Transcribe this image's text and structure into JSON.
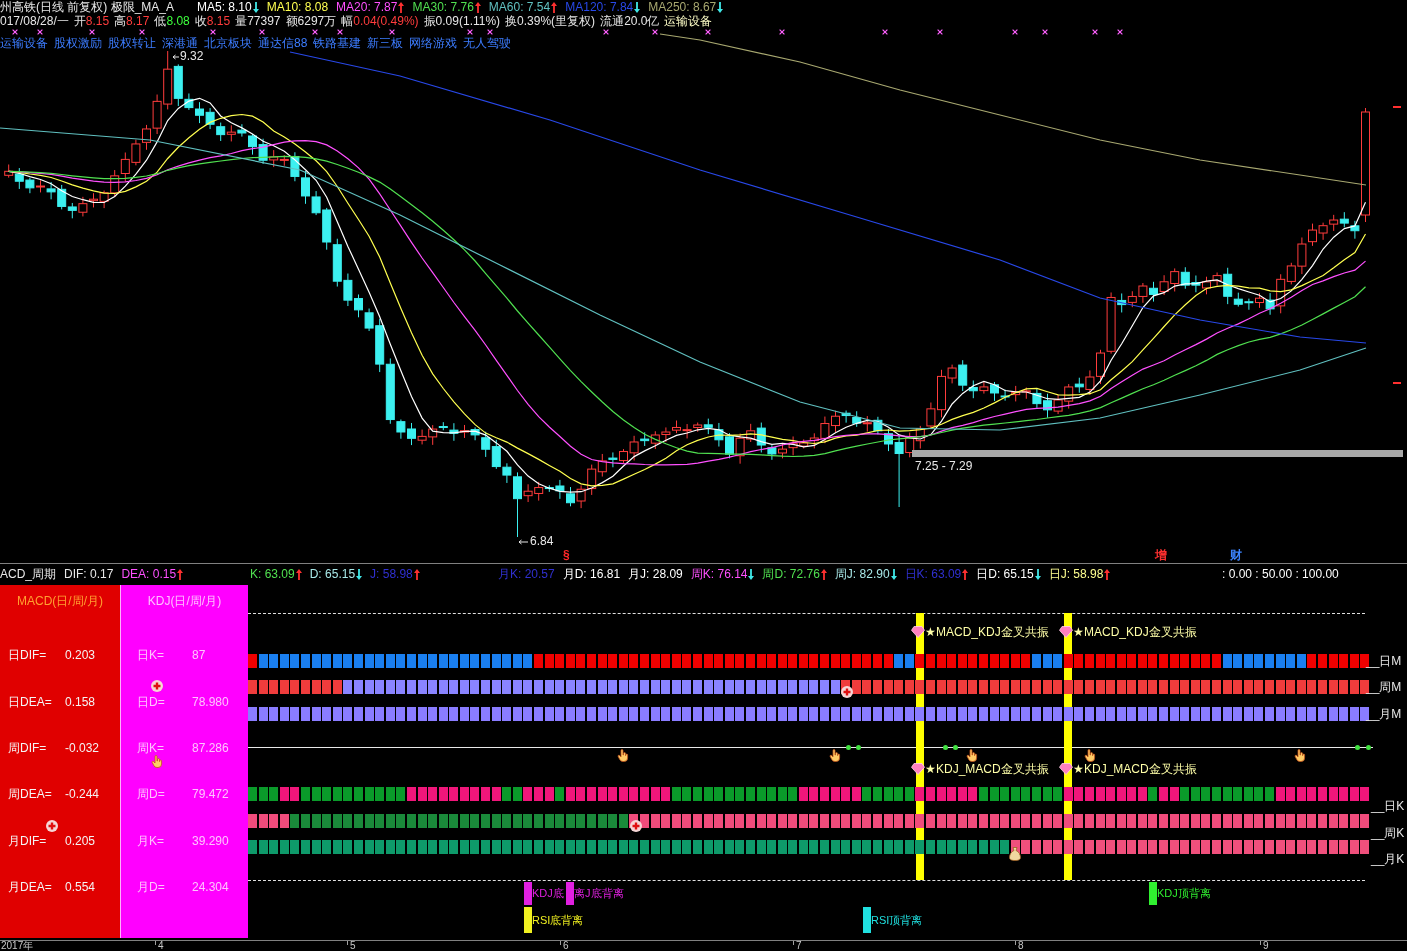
{
  "header": {
    "title": "州高铁(日线 前复权) 极限_MA_A",
    "ma_readings": [
      {
        "text": "MA5: 8.10",
        "color": "#ffffff",
        "rising": false
      },
      {
        "text": "MA10: 8.08",
        "color": "#ffff50"
      },
      {
        "text": "MA20: 7.87",
        "color": "#ff50ff",
        "rising": true
      },
      {
        "text": "MA30: 7.76",
        "color": "#50e050",
        "rising": true
      },
      {
        "text": "MA60: 7.54",
        "color": "#60c0c0",
        "rising": true
      },
      {
        "text": "MA120: 7.84",
        "color": "#2848e8",
        "rising": false
      },
      {
        "text": "MA250: 8.67",
        "color": "#a8a870",
        "rising": false
      }
    ]
  },
  "quote": {
    "date": "017/08/28/一",
    "fields": [
      {
        "label": "开",
        "value": "8.15",
        "color": "#ff3c3c"
      },
      {
        "label": "高",
        "value": "8.17",
        "color": "#ff3c3c"
      },
      {
        "label": "低",
        "value": "8.08",
        "color": "#3cff3c"
      },
      {
        "label": "收",
        "value": "8.15",
        "color": "#ff3c3c"
      },
      {
        "label": "量",
        "value": "77397",
        "color": "#e6e6e6"
      },
      {
        "label": "额",
        "value": "6297万",
        "color": "#e6e6e6"
      },
      {
        "label": "幅",
        "value": "0.04(0.49%)",
        "color": "#ff3c3c"
      },
      {
        "label": "振",
        "value": "0.09(1.11%)",
        "color": "#e6e6e6"
      },
      {
        "label": "换",
        "value": "0.39%(里复权)",
        "color": "#e6e6e6"
      },
      {
        "label": "流通",
        "value": "20.0亿",
        "color": "#e6e6e6"
      }
    ],
    "sector": "运输设备"
  },
  "concepts": [
    "运输设备",
    "股权激励",
    "股权转让",
    "深港通",
    "北京板块",
    "通达信88",
    "铁路基建",
    "新三板",
    "网络游戏",
    "无人驾驶"
  ],
  "chart": {
    "high_label": "9.32",
    "low_label": "6.84",
    "range_label": "7.25 - 7.29",
    "event_marks": [
      {
        "text": "§",
        "color": "#ff2828"
      },
      {
        "text": "增",
        "color": "#ff3030"
      },
      {
        "text": "财",
        "color": "#3c84ff"
      }
    ]
  },
  "indicator_bar": {
    "groups": [
      [
        {
          "text": "ACD_周期",
          "color": "#e8e8e8"
        },
        {
          "text": "DIF: 0.17",
          "color": "#e8e8e8"
        },
        {
          "text": "DEA: 0.15",
          "color": "#ff50ff",
          "rising": true
        }
      ],
      [
        {
          "text": "K: 63.09",
          "color": "#50e050",
          "rising": true
        },
        {
          "text": "D: 65.15",
          "color": "#a8e8e8",
          "rising": false
        },
        {
          "text": "J: 58.98",
          "color": "#3030d0",
          "rising": true
        }
      ],
      [
        {
          "text": "月K: 20.57",
          "color": "#3030d0"
        },
        {
          "text": "月D: 16.81",
          "color": "#ffffff"
        },
        {
          "text": "月J: 28.09",
          "color": "#ffffff"
        },
        {
          "text": "周K: 76.14",
          "color": "#ff50ff",
          "rising": false
        },
        {
          "text": "周D: 72.76",
          "color": "#50e050",
          "rising": true
        },
        {
          "text": "周J: 82.90",
          "color": "#a8e8e8",
          "rising": false
        },
        {
          "text": "日K: 63.09",
          "color": "#3030d0",
          "rising": true
        },
        {
          "text": "日D: 65.15",
          "color": "#ffffff",
          "rising": false
        },
        {
          "text": "日J: 58.98",
          "color": "#ffff90",
          "rising": true
        }
      ],
      [
        {
          "text": ": 0.00 : 50.00 : 100.00",
          "color": "#ffffff"
        }
      ]
    ]
  },
  "macd_panel": {
    "title": "MACD(日/周/月)",
    "rows": [
      {
        "label": "日DIF=",
        "value": "0.203"
      },
      {
        "label": "日DEA=",
        "value": "0.158"
      },
      {
        "label": "周DIF=",
        "value": "-0.032"
      },
      {
        "label": "周DEA=",
        "value": "-0.244"
      },
      {
        "label": "月DIF=",
        "value": "0.205"
      },
      {
        "label": "月DEA=",
        "value": "0.554"
      }
    ]
  },
  "kdj_panel": {
    "title": "KDJ(日/周/月)",
    "rows": [
      {
        "label": "日K=",
        "value": "87"
      },
      {
        "label": "日D=",
        "value": "78.980"
      },
      {
        "label": "周K=",
        "value": "87.286"
      },
      {
        "label": "周D=",
        "value": "79.472"
      },
      {
        "label": "月K=",
        "value": "39.290"
      },
      {
        "label": "月D=",
        "value": "24.304"
      }
    ]
  },
  "signals": {
    "macd_kdj_labels": [
      "★MACD_KDJ金叉共振",
      "★MACD_KDJ金叉共振"
    ],
    "kdj_macd_labels": [
      "★KDJ_MACD金叉共振",
      "★KDJ_MACD金叉共振"
    ],
    "ma_rows": [
      {
        "label": "__日M",
        "bullish": [
          true,
          false,
          false,
          false,
          false,
          false,
          false,
          false,
          false,
          false,
          false,
          false,
          false,
          false,
          false,
          false,
          false,
          false,
          false,
          false,
          false,
          false,
          false,
          false,
          false,
          false,
          false,
          true,
          true,
          true,
          true,
          true,
          true,
          true,
          true,
          true,
          true,
          true,
          true,
          true,
          true,
          true,
          true,
          true,
          true,
          true,
          true,
          true,
          true,
          true,
          true,
          true,
          true,
          true,
          true,
          true,
          true,
          true,
          true,
          true,
          true,
          false,
          false,
          true,
          true,
          true,
          true,
          true,
          true,
          true,
          true,
          true,
          true,
          true,
          false,
          false,
          false,
          true,
          true,
          true,
          true,
          true,
          true,
          true,
          true,
          true,
          true,
          true,
          true,
          true,
          true,
          true,
          false,
          false,
          false,
          false,
          false,
          false,
          false,
          false,
          true,
          true,
          true,
          true,
          true,
          true
        ]
      },
      {
        "label": "__周M",
        "bullish": [
          true,
          true,
          true,
          true,
          true,
          true,
          true,
          true,
          true,
          false,
          false,
          false,
          false,
          false,
          false,
          false,
          false,
          false,
          false,
          false,
          false,
          false,
          false,
          false,
          false,
          false,
          false,
          false,
          false,
          false,
          false,
          false,
          false,
          false,
          false,
          false,
          false,
          false,
          false,
          false,
          false,
          false,
          false,
          false,
          false,
          false,
          false,
          false,
          false,
          false,
          false,
          false,
          false,
          false,
          false,
          false,
          true,
          true,
          true,
          true,
          true,
          true,
          true,
          true,
          true,
          true,
          true,
          true,
          true,
          true,
          true,
          true,
          true,
          true,
          true,
          true,
          true,
          true,
          true,
          true,
          true,
          true,
          true,
          true,
          true,
          true,
          true,
          true,
          true,
          true,
          true,
          true,
          true,
          true,
          true,
          true,
          true,
          true,
          true,
          true,
          true,
          true,
          true,
          true,
          true,
          true
        ]
      },
      {
        "label": "__月M",
        "bullish": [
          false,
          false,
          false,
          false,
          false,
          false,
          false,
          false,
          false,
          false,
          false,
          false,
          false,
          false,
          false,
          false,
          false,
          false,
          false,
          false,
          false,
          false,
          false,
          false,
          false,
          false,
          false,
          false,
          false,
          false,
          false,
          false,
          false,
          false,
          false,
          false,
          false,
          false,
          false,
          false,
          false,
          false,
          false,
          false,
          false,
          false,
          false,
          false,
          false,
          false,
          false,
          false,
          false,
          false,
          false,
          false,
          false,
          false,
          false,
          false,
          false,
          false,
          false,
          false,
          false,
          false,
          false,
          false,
          false,
          false,
          false,
          false,
          false,
          false,
          false,
          false,
          false,
          false,
          false,
          false,
          false,
          false,
          false,
          false,
          false,
          false,
          false,
          false,
          false,
          false,
          false,
          false,
          false,
          false,
          false,
          false,
          false,
          false,
          false,
          false,
          false,
          false,
          false,
          false,
          false,
          false
        ]
      }
    ],
    "kdj_rows": [
      {
        "label": "__日K",
        "bullish": [
          false,
          false,
          false,
          true,
          true,
          false,
          false,
          false,
          false,
          false,
          false,
          false,
          false,
          false,
          false,
          true,
          true,
          true,
          true,
          true,
          true,
          true,
          true,
          true,
          false,
          false,
          true,
          true,
          true,
          false,
          true,
          true,
          true,
          true,
          true,
          true,
          true,
          true,
          true,
          true,
          false,
          false,
          false,
          false,
          false,
          false,
          false,
          false,
          false,
          false,
          false,
          false,
          true,
          true,
          true,
          true,
          true,
          true,
          false,
          false,
          false,
          false,
          false,
          true,
          true,
          true,
          true,
          true,
          true,
          false,
          false,
          false,
          false,
          false,
          false,
          false,
          false,
          true,
          true,
          true,
          true,
          true,
          true,
          true,
          true,
          false,
          true,
          true,
          false,
          false,
          false,
          false,
          false,
          false,
          false,
          false,
          false,
          true,
          true,
          true,
          true,
          true,
          true,
          true,
          true,
          true
        ]
      },
      {
        "label": "__周K",
        "bullish": [
          true,
          true,
          true,
          true,
          false,
          false,
          false,
          false,
          false,
          false,
          false,
          false,
          false,
          false,
          false,
          false,
          false,
          false,
          false,
          false,
          false,
          false,
          false,
          false,
          false,
          false,
          false,
          false,
          false,
          false,
          false,
          false,
          false,
          false,
          false,
          false,
          true,
          true,
          true,
          true,
          true,
          true,
          true,
          true,
          true,
          true,
          true,
          true,
          true,
          true,
          true,
          true,
          true,
          true,
          true,
          true,
          true,
          true,
          true,
          true,
          true,
          true,
          true,
          true,
          true,
          true,
          true,
          true,
          true,
          true,
          true,
          true,
          true,
          true,
          true,
          true,
          true,
          true,
          true,
          true,
          true,
          true,
          true,
          true,
          true,
          true,
          true,
          true,
          true,
          true,
          true,
          true,
          true,
          true,
          true,
          true,
          true,
          true,
          true,
          true,
          true,
          true,
          true,
          true,
          true,
          true
        ]
      },
      {
        "label": "__月K",
        "bullish": [
          false,
          false,
          false,
          false,
          false,
          false,
          false,
          false,
          false,
          false,
          false,
          false,
          false,
          false,
          false,
          false,
          false,
          false,
          false,
          false,
          false,
          false,
          false,
          false,
          false,
          false,
          false,
          false,
          false,
          false,
          false,
          false,
          false,
          false,
          false,
          false,
          false,
          false,
          false,
          false,
          false,
          false,
          false,
          false,
          false,
          false,
          false,
          false,
          false,
          false,
          false,
          false,
          false,
          false,
          false,
          false,
          false,
          false,
          false,
          false,
          false,
          false,
          false,
          false,
          false,
          false,
          false,
          false,
          false,
          false,
          false,
          false,
          true,
          true,
          true,
          true,
          true,
          true,
          true,
          true,
          true,
          true,
          true,
          true,
          true,
          true,
          true,
          true,
          true,
          true,
          true,
          true,
          true,
          true,
          true,
          true,
          true,
          true,
          true,
          true,
          true,
          true,
          true,
          true,
          true,
          true
        ]
      }
    ],
    "kdj_divergences": [
      {
        "text": "KDJ底",
        "color": "#e020e0"
      },
      {
        "text": "离J底背离",
        "color": "#e020e0"
      },
      {
        "text": "KDJ顶背离",
        "color": "#30f030"
      }
    ],
    "rsi_divergences": [
      {
        "text": "RSI底背离",
        "color": "#f0f020"
      },
      {
        "text": "RSI顶背离",
        "color": "#20e0e0"
      }
    ]
  },
  "time_axis": [
    "2017年",
    "4",
    "5",
    "6",
    "7",
    "8",
    "9"
  ]
}
